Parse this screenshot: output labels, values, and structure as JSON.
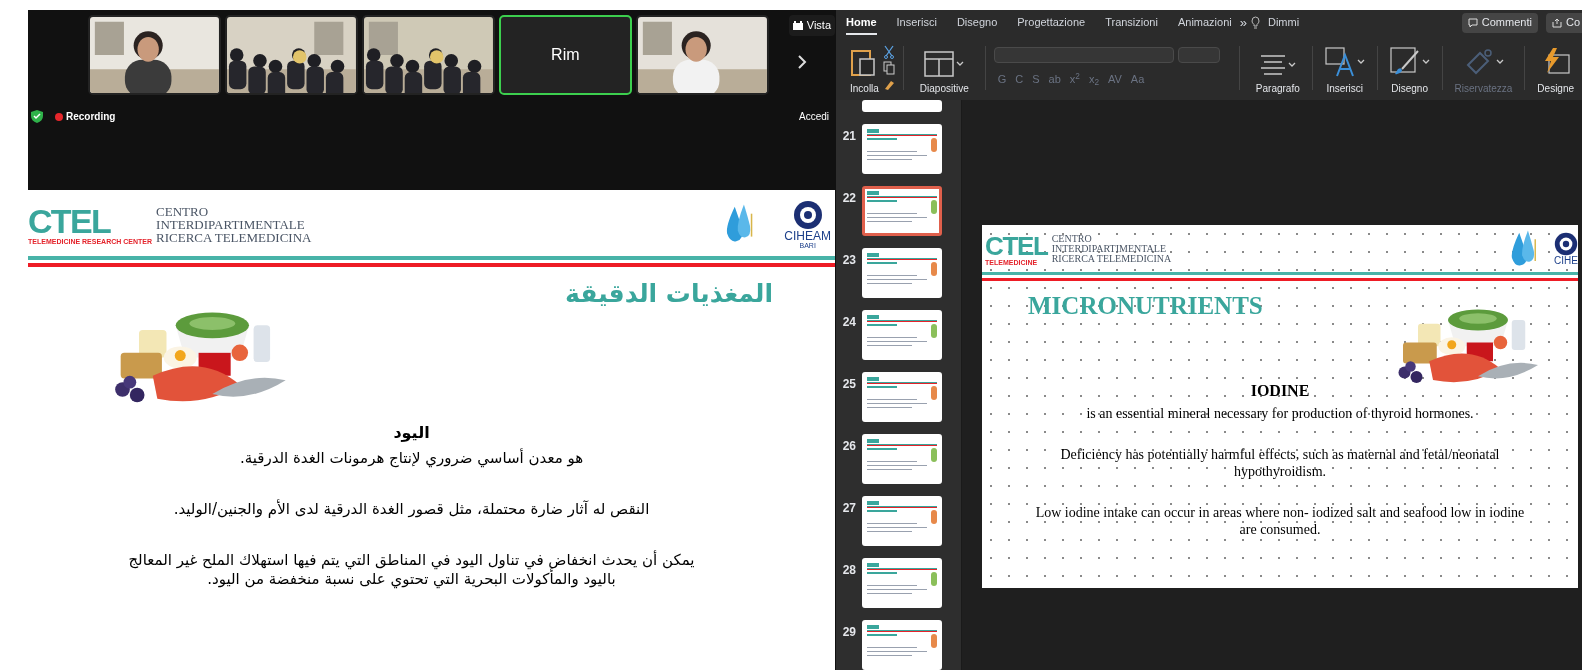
{
  "meeting": {
    "tiles": [
      {
        "kind": "video",
        "speaking": false
      },
      {
        "kind": "video",
        "speaking": false
      },
      {
        "kind": "video",
        "speaking": false
      },
      {
        "kind": "name",
        "name": "Rim",
        "speaking": true
      },
      {
        "kind": "video",
        "speaking": false
      }
    ],
    "view_button": "Vista",
    "recording": "Recording",
    "sign_in": "Accedi"
  },
  "shared_slide": {
    "logo": {
      "mark": "CTEL",
      "tagline": "TELEMEDICINE RESEARCH CENTER",
      "lines": [
        "CENTRO",
        "INTERDIPARTIMENTALE",
        "RICERCA TELEMEDICINA"
      ]
    },
    "partner": {
      "name": "CIHEAM",
      "city": "BARI"
    },
    "title": "المغذيات الدقيقة",
    "heading": "اليود",
    "paragraphs": [
      "هو معدن أساسي ضروري لإنتاج هرمونات الغدة الدرقية.",
      "النقص له آثار ضارة محتملة، مثل قصور الغدة الدرقية لدى الأم والجنين/الوليد.",
      "يمكن أن يحدث انخفاض في تناول اليود في المناطق التي يتم فيها استهلاك الملح غير المعالج باليود والمأكولات البحرية التي تحتوي على نسبة منخفضة من اليود."
    ]
  },
  "ribbon": {
    "tabs": [
      {
        "label": "Home",
        "selected": true
      },
      {
        "label": "Inserisci",
        "selected": false
      },
      {
        "label": "Disegno",
        "selected": false
      },
      {
        "label": "Progettazione",
        "selected": false
      },
      {
        "label": "Transizioni",
        "selected": false
      },
      {
        "label": "Animazioni",
        "selected": false
      }
    ],
    "more": "»",
    "tell_me": "Dimmi",
    "comments": "Commenti",
    "share": "Co",
    "tools": [
      {
        "label": "Incolla",
        "disabled": false
      },
      {
        "label": "Diapositive",
        "disabled": false
      },
      {
        "label": "Paragrafo",
        "disabled": false
      },
      {
        "label": "Inserisci",
        "disabled": false
      },
      {
        "label": "Disegno",
        "disabled": false
      },
      {
        "label": "Riservatezza",
        "disabled": true
      },
      {
        "label": "Designe",
        "disabled": false
      }
    ],
    "format_buttons": [
      "G",
      "C",
      "S",
      "ab",
      "x$^{2}$",
      "x$_{2}$",
      "AV",
      "Aa"
    ]
  },
  "thumbnails": [
    {
      "selected": false
    },
    {
      "number": "21",
      "selected": false
    },
    {
      "number": "22",
      "selected": true
    },
    {
      "number": "23",
      "selected": false
    },
    {
      "number": "24",
      "selected": false
    },
    {
      "number": "25",
      "selected": false
    },
    {
      "number": "26",
      "selected": false
    },
    {
      "number": "27",
      "selected": false
    },
    {
      "number": "28",
      "selected": false
    },
    {
      "number": "29",
      "selected": false
    }
  ],
  "slide": {
    "logo": {
      "mark": "CTEL",
      "tagline": "TELEMEDICINE",
      "lines": [
        "CENTRO",
        "INTERDIPARTIMENTALE",
        "RICERCA TELEMEDICINA"
      ]
    },
    "partner": "CIHE",
    "title": "MICRONUTRIENTS",
    "heading": "IODINE",
    "paragraphs": [
      "is an essential mineral necessary for production of thyroid hormones.",
      "Deficiency has potentially harmful effects, such as maternal and fetal/neonatal hypothyroidism.",
      "Low iodine intake can occur in areas where non- iodized salt and seafood low in iodine are consumed."
    ]
  }
}
